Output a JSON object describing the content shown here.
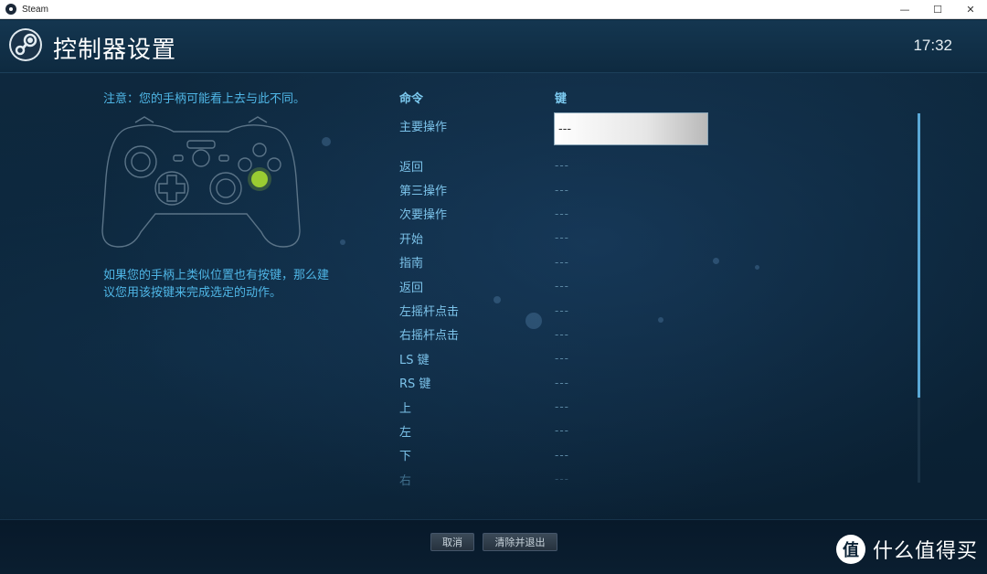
{
  "window": {
    "title": "Steam",
    "minimize": "—",
    "maximize": "☐",
    "close": "✕"
  },
  "header": {
    "title": "控制器设置",
    "clock": "17:32"
  },
  "left": {
    "note": "注意：您的手柄可能看上去与此不同。",
    "hint": "如果您的手柄上类似位置也有按键，那么建议您用该按键来完成选定的动作。"
  },
  "table": {
    "col_command": "命令",
    "col_key": "键",
    "rows": [
      {
        "cmd": "主要操作",
        "key": "---"
      },
      {
        "cmd": "返回",
        "key": "---"
      },
      {
        "cmd": "第三操作",
        "key": "---"
      },
      {
        "cmd": "次要操作",
        "key": "---"
      },
      {
        "cmd": "开始",
        "key": "---"
      },
      {
        "cmd": "指南",
        "key": "---"
      },
      {
        "cmd": "返回",
        "key": "---"
      },
      {
        "cmd": "左摇杆点击",
        "key": "---"
      },
      {
        "cmd": "右摇杆点击",
        "key": "---"
      },
      {
        "cmd": "LS 键",
        "key": "---"
      },
      {
        "cmd": "RS 键",
        "key": "---"
      },
      {
        "cmd": "上",
        "key": "---"
      },
      {
        "cmd": "左",
        "key": "---"
      },
      {
        "cmd": "下",
        "key": "---"
      },
      {
        "cmd": "右",
        "key": "---"
      }
    ]
  },
  "scrollbar": {
    "position_fraction": 0.0,
    "visible_fraction": 0.77
  },
  "footer": {
    "cancel": "取消",
    "clear_exit": "清除并退出"
  },
  "watermark": {
    "badge": "值",
    "text": "什么值得买"
  },
  "colors": {
    "accent": "#4fb6e6",
    "highlight_button": "#9acd32",
    "background": "#0b2235"
  }
}
